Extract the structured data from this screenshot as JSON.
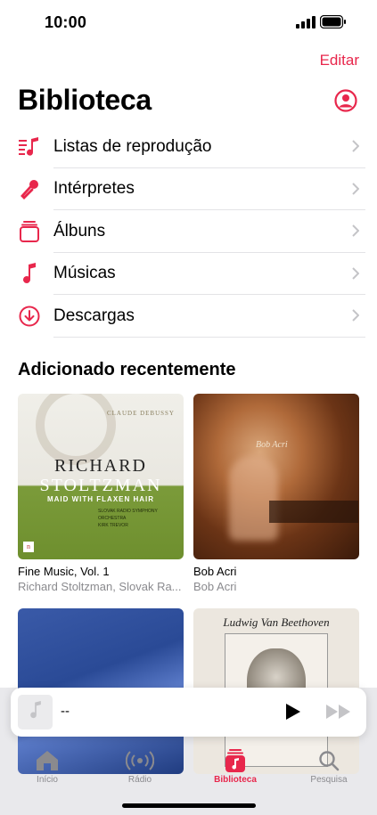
{
  "status_bar": {
    "time": "10:00"
  },
  "header": {
    "edit_label": "Editar",
    "title": "Biblioteca"
  },
  "menu": [
    {
      "label": "Listas de reprodução",
      "icon": "playlist-icon"
    },
    {
      "label": "Intérpretes",
      "icon": "microphone-icon"
    },
    {
      "label": "Álbuns",
      "icon": "album-stack-icon"
    },
    {
      "label": "Músicas",
      "icon": "music-note-icon"
    },
    {
      "label": "Descargas",
      "icon": "download-circle-icon"
    }
  ],
  "recent": {
    "section_title": "Adicionado recentemente",
    "albums": [
      {
        "title": "Fine Music, Vol. 1",
        "artist": "Richard Stoltzman, Slovak Ra...",
        "art": {
          "composer": "CLAUDE DEBUSSY",
          "line1": "RICHARD",
          "line2": "STOLTZMAN",
          "sub": "MAID WITH FLAXEN HAIR",
          "info1": "SLOVAK RADIO SYMPHONY ORCHESTRA",
          "info2": "KIRK TREVOR"
        }
      },
      {
        "title": "Bob Acri",
        "artist": "Bob Acri",
        "art": {
          "name": "Bob Acri"
        }
      },
      {
        "title": "",
        "artist": "",
        "art": {}
      },
      {
        "title": "",
        "artist": "",
        "art": {
          "name": "Ludwig Van Beethoven"
        }
      }
    ]
  },
  "mini_player": {
    "title": "--"
  },
  "tabs": [
    {
      "label": "Início",
      "icon": "home-icon",
      "active": false
    },
    {
      "label": "Rádio",
      "icon": "radio-icon",
      "active": false
    },
    {
      "label": "Biblioteca",
      "icon": "library-icon",
      "active": true
    },
    {
      "label": "Pesquisa",
      "icon": "search-icon",
      "active": false
    }
  ],
  "colors": {
    "accent": "#e8274c",
    "secondary_text": "#8a8a8e",
    "tab_bar": "#e9e9ec"
  }
}
